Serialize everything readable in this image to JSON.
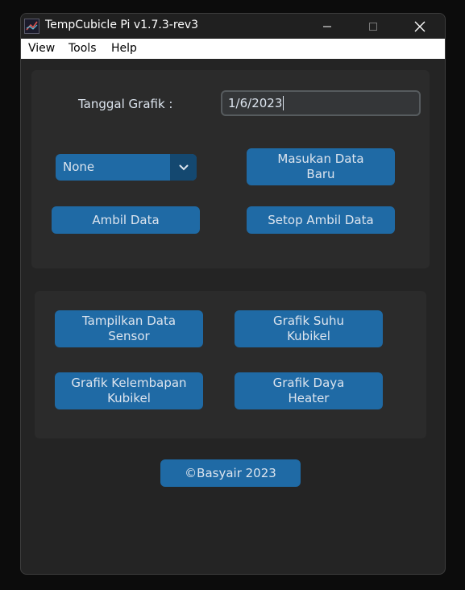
{
  "window": {
    "title": "TempCubicle Pi v1.7.3-rev3",
    "controls": {
      "minimize_icon": "minimize-icon",
      "maximize_icon": "maximize-icon",
      "close_icon": "close-icon"
    }
  },
  "menu": {
    "items": [
      "View",
      "Tools",
      "Help"
    ]
  },
  "form": {
    "date_label": "Tanggal Grafik :",
    "date_value": "1/6/2023",
    "combo_value": "None",
    "combo_icon": "chevron-down-icon"
  },
  "top_buttons": {
    "masukan": "Masukan Data\nBaru",
    "ambil": "Ambil Data",
    "setop": "Setop Ambil Data"
  },
  "mid_buttons": {
    "tampilkan": "Tampilkan Data\nSensor",
    "suhu": "Grafik Suhu\nKubikel",
    "kelembapan": "Grafik Kelembapan\nKubikel",
    "daya": "Grafik Daya\nHeater"
  },
  "footer": {
    "credit": "©Basyair 2023"
  },
  "colors": {
    "button": "#1f6aa5",
    "button_dark": "#144870",
    "panel": "#2b2b2b",
    "window_bg": "#242424",
    "text": "#dce4ee"
  }
}
